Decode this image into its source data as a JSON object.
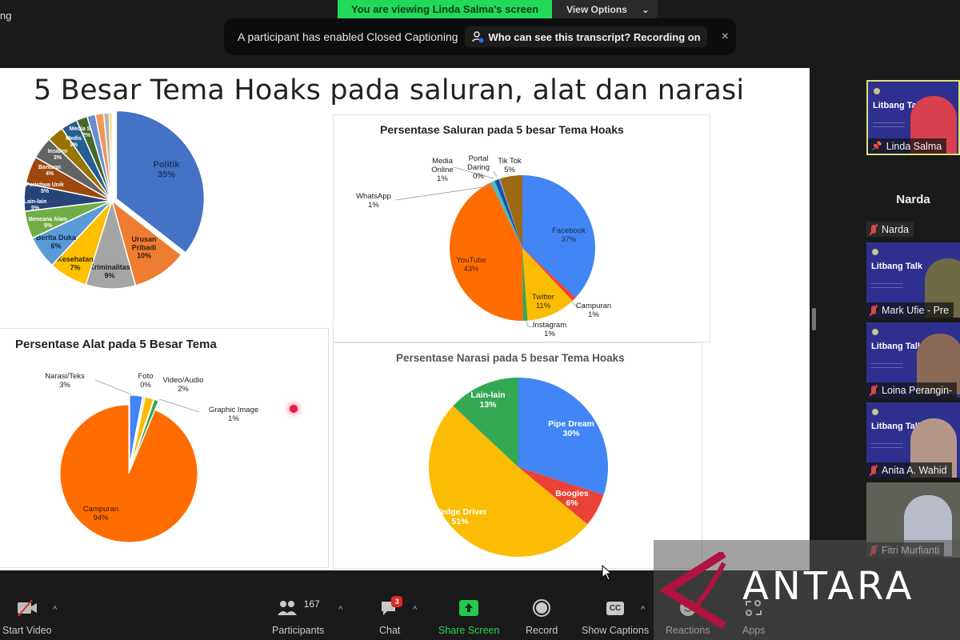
{
  "window": {
    "top_left_text": "ng",
    "viewing_banner": "You are viewing Linda Salma's screen",
    "view_options_label": "View Options",
    "cc_notice": "A participant has enabled Closed Captioning",
    "cc_link": "Who can see this transcript? Recording on",
    "close_symbol": "×"
  },
  "slide": {
    "title": "5 Besar Tema Hoaks pada saluran, alat dan narasi"
  },
  "chart_data": [
    {
      "id": "tema",
      "type": "pie",
      "title": "",
      "slices": [
        {
          "label": "Politik",
          "value": 35,
          "color": "#4472c4"
        },
        {
          "label": "Urusan Pribadi",
          "value": 10,
          "color": "#ed7d31"
        },
        {
          "label": "Kriminalitas",
          "value": 9,
          "color": "#a5a5a5"
        },
        {
          "label": "Kesehatan",
          "value": 7,
          "color": "#ffc000"
        },
        {
          "label": "Berita Duka",
          "value": 6,
          "color": "#5b9bd5"
        },
        {
          "label": "Bencana Alam",
          "value": 5,
          "color": "#70ad47"
        },
        {
          "label": "Lain-lain",
          "value": 5,
          "color": "#264478"
        },
        {
          "label": "Peristiwa Unik",
          "value": 5,
          "color": "#9e480e"
        },
        {
          "label": "Bantuan",
          "value": 4,
          "color": "#636363"
        },
        {
          "label": "Insiden",
          "value": 3,
          "color": "#997300"
        },
        {
          "label": "Medis",
          "value": 3,
          "color": "#255e91"
        },
        {
          "label": "Media Sosial",
          "value": 2,
          "color": "#43682b"
        },
        {
          "label": "",
          "value": 1.5,
          "color": "#698ed0"
        },
        {
          "label": "",
          "value": 1.5,
          "color": "#f1975a"
        },
        {
          "label": "",
          "value": 1,
          "color": "#b7b7b7"
        },
        {
          "label": "",
          "value": 0.5,
          "color": "#ffcd33"
        }
      ]
    },
    {
      "id": "saluran",
      "type": "pie",
      "title": "Persentase Saluran pada 5 besar Tema Hoaks",
      "slices": [
        {
          "label": "Facebook",
          "value": 37,
          "color": "#4285f4"
        },
        {
          "label": "Campuran",
          "value": 1,
          "color": "#ea4335"
        },
        {
          "label": "Twitter",
          "value": 11,
          "color": "#fbbc04"
        },
        {
          "label": "Instagram",
          "value": 1,
          "color": "#34a853"
        },
        {
          "label": "YouTube",
          "value": 43,
          "color": "#ff6d01"
        },
        {
          "label": "WhatsApp",
          "value": 1,
          "color": "#46bdc6"
        },
        {
          "label": "Media Online",
          "value": 1,
          "color": "#1e4fa3"
        },
        {
          "label": "Portal Daring",
          "value": 0,
          "color": "#7baaf7"
        },
        {
          "label": "Tik Tok",
          "value": 5,
          "color": "#9c6a12"
        }
      ]
    },
    {
      "id": "alat",
      "type": "pie",
      "title": "Persentase Alat pada 5 Besar Tema",
      "slices": [
        {
          "label": "Narasi/Teks",
          "value": 3,
          "color": "#4285f4"
        },
        {
          "label": "Foto",
          "value": 0,
          "color": "#ea4335"
        },
        {
          "label": "Video/Audio",
          "value": 2,
          "color": "#fbbc04"
        },
        {
          "label": "Graphic Image",
          "value": 1,
          "color": "#34a853"
        },
        {
          "label": "Campuran",
          "value": 94,
          "color": "#ff6d01"
        }
      ]
    },
    {
      "id": "narasi",
      "type": "pie",
      "title": "Persentase Narasi pada 5 besar Tema Hoaks",
      "slices": [
        {
          "label": "Pipe Dream",
          "value": 30,
          "color": "#4285f4"
        },
        {
          "label": "Boogies",
          "value": 6,
          "color": "#ea4335"
        },
        {
          "label": "Wedge Driver",
          "value": 51,
          "color": "#fbbc04"
        },
        {
          "label": "Lain-lain",
          "value": 13,
          "color": "#34a853"
        }
      ]
    }
  ],
  "participants_panel": {
    "tiles": [
      {
        "name": "Linda Salma",
        "brand": "Litbang Talk",
        "active": true
      },
      {
        "name": "Narda",
        "big_name": "Narda"
      },
      {
        "name": "Mark Ufie - Pre",
        "brand": "Litbang Talk"
      },
      {
        "name": "Loina Perangin-",
        "brand": "Litbang Talk"
      },
      {
        "name": "Anita A. Wahid",
        "brand": "Litbang Talk"
      },
      {
        "name": "Fitri Murfianti"
      }
    ]
  },
  "toolbar": {
    "start_video": "Start Video",
    "participants": "Participants",
    "participants_count": "167",
    "chat": "Chat",
    "chat_badge": "3",
    "share_screen": "Share Screen",
    "record": "Record",
    "show_captions": "Show Captions",
    "cc_icon_text": "CC",
    "reactions": "Reactions",
    "apps": "Apps",
    "caret": "^"
  },
  "watermark": {
    "text": "ANTARA",
    "accent_color": "#b0133f"
  },
  "colors": {
    "share_green": "#23d959",
    "active_speaker_border": "#dde276",
    "badge_red": "#e02828",
    "tile_bg": "#2e2f8f"
  }
}
